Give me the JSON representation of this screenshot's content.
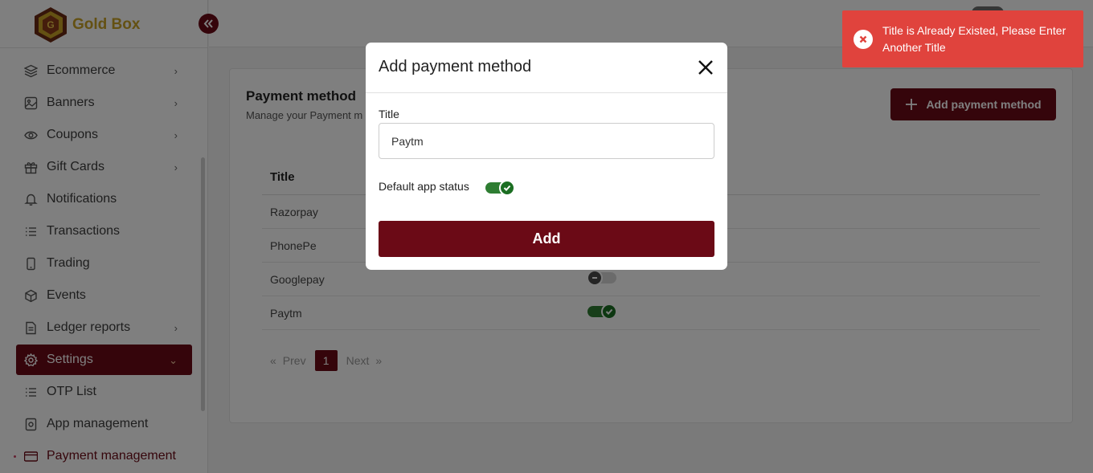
{
  "brand": {
    "name": "Gold Box",
    "color": "#c9a227"
  },
  "colors": {
    "primary": "#6b0a16",
    "success": "#2e7d32",
    "toast": "#e0433d"
  },
  "sidebar": {
    "items": [
      {
        "label": "Ecommerce",
        "icon": "layers-icon",
        "has_chevron": true
      },
      {
        "label": "Banners",
        "icon": "image-icon",
        "has_chevron": true
      },
      {
        "label": "Coupons",
        "icon": "eye-icon",
        "has_chevron": true
      },
      {
        "label": "Gift Cards",
        "icon": "gift-icon",
        "has_chevron": true
      },
      {
        "label": "Notifications",
        "icon": "bell-icon",
        "has_chevron": false
      },
      {
        "label": "Transactions",
        "icon": "list-icon",
        "has_chevron": false
      },
      {
        "label": "Trading",
        "icon": "phone-icon",
        "has_chevron": false
      },
      {
        "label": "Events",
        "icon": "cube-icon",
        "has_chevron": false
      },
      {
        "label": "Ledger reports",
        "icon": "document-icon",
        "has_chevron": true
      },
      {
        "label": "Settings",
        "icon": "gear-icon",
        "has_chevron": true,
        "active": true
      },
      {
        "label": "OTP List",
        "icon": "list-icon",
        "has_chevron": false
      },
      {
        "label": "App management",
        "icon": "app-icon",
        "has_chevron": false
      },
      {
        "label": "Payment management",
        "icon": "card-icon",
        "has_chevron": false,
        "current": true
      }
    ]
  },
  "page": {
    "title": "Payment method",
    "subtitle": "Manage your Payment m",
    "add_button_label": "Add payment method"
  },
  "table": {
    "header": "Title",
    "rows": [
      {
        "title": "Razorpay",
        "status": null
      },
      {
        "title": "PhonePe",
        "status": null
      },
      {
        "title": "Googlepay",
        "status": "off"
      },
      {
        "title": "Paytm",
        "status": "on"
      }
    ]
  },
  "pagination": {
    "prev": "Prev",
    "next": "Next",
    "current": "1",
    "prev_arrow": "«",
    "next_arrow": "»"
  },
  "modal": {
    "title": "Add payment method",
    "field_label": "Title",
    "field_value": "Paytm",
    "status_label": "Default app status",
    "status": "on",
    "submit_label": "Add"
  },
  "toast": {
    "message": "Title is Already Existed, Please Enter Another Title",
    "type": "error"
  }
}
